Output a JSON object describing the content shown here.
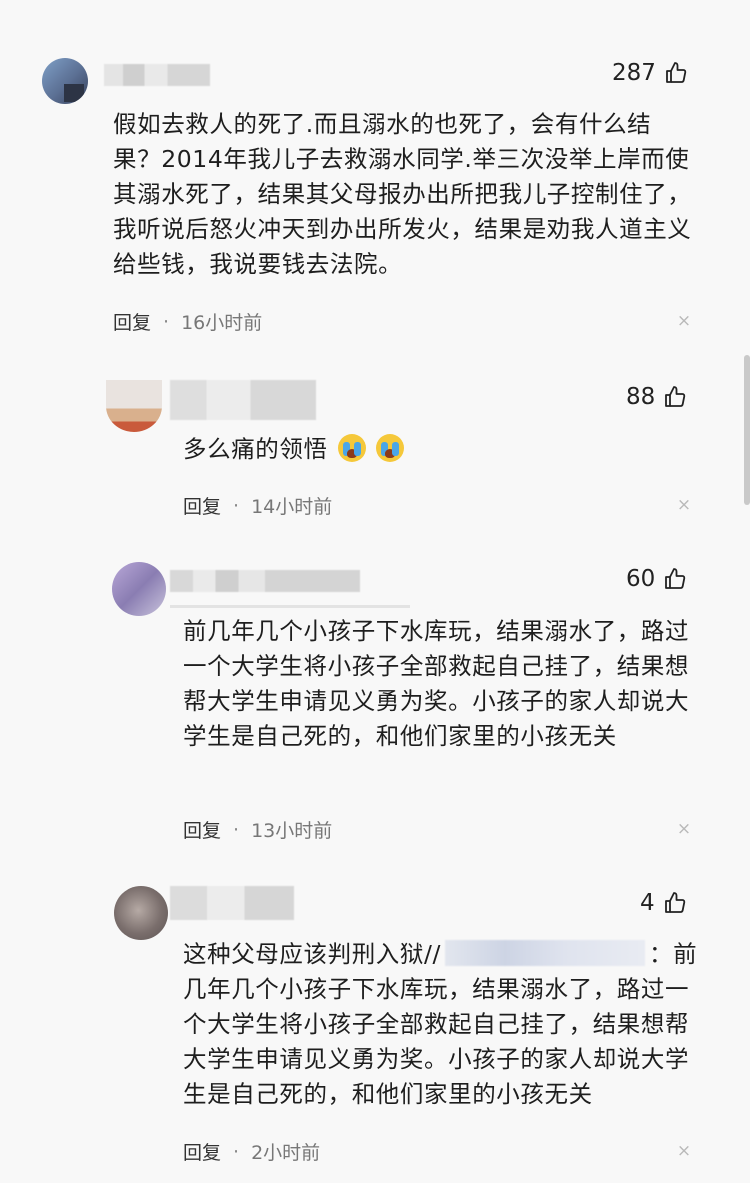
{
  "comments": [
    {
      "likes": "287",
      "text": "假如去救人的死了.而且溺水的也死了，会有什么结果？2014年我儿子去救溺水同学.举三次没举上岸而使其溺水死了，结果其父母报办出所把我儿子控制住了，我听说后怒火冲天到办出所发火，结果是劝我人道主义给些钱，我说要钱去法院。",
      "reply_label": "回复",
      "separator": "·",
      "time": "16小时前",
      "close": "×"
    },
    {
      "likes": "88",
      "text": "多么痛的领悟",
      "emojis": [
        "crying-face",
        "crying-face"
      ],
      "reply_label": "回复",
      "separator": "·",
      "time": "14小时前",
      "close": "×"
    },
    {
      "likes": "60",
      "text": "前几年几个小孩子下水库玩，结果溺水了，路过一个大学生将小孩子全部救起自己挂了，结果想帮大学生申请见义勇为奖。小孩子的家人却说大学生是自己死的，和他们家里的小孩无关",
      "reply_label": "回复",
      "separator": "·",
      "time": "13小时前",
      "close": "×"
    },
    {
      "likes": "4",
      "text_before": "这种父母应该判刑入狱//",
      "text_after": "：前几年几个小孩子下水库玩，结果溺水了，路过一个大学生将小孩子全部救起自己挂了，结果想帮大学生申请见义勇为奖。小孩子的家人却说大学生是自己死的，和他们家里的小孩无关",
      "reply_label": "回复",
      "separator": "·",
      "time": "2小时前",
      "close": "×"
    }
  ]
}
